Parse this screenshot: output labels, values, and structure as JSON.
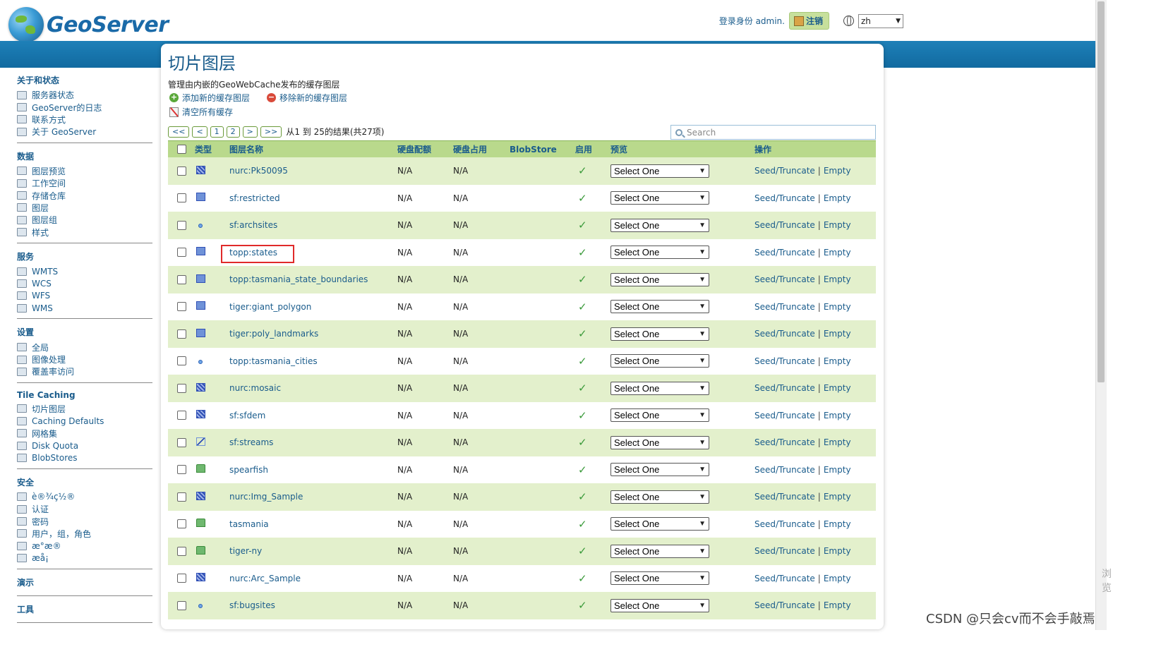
{
  "header": {
    "logo_text": "GeoServer",
    "login_text": "登录身份 admin.",
    "logout_label": "注销",
    "lang_value": "zh"
  },
  "sidebar": [
    {
      "title": "关于和状态",
      "items": [
        {
          "label": "服务器状态",
          "icon": "server-status-icon"
        },
        {
          "label": "GeoServer的日志",
          "icon": "log-icon"
        },
        {
          "label": "联系方式",
          "icon": "contact-icon"
        },
        {
          "label": "关于 GeoServer",
          "icon": "about-icon"
        }
      ]
    },
    {
      "title": "数据",
      "items": [
        {
          "label": "图层预览",
          "icon": "layer-preview-icon"
        },
        {
          "label": "工作空间",
          "icon": "workspace-icon"
        },
        {
          "label": "存储仓库",
          "icon": "store-icon"
        },
        {
          "label": "图层",
          "icon": "layer-icon"
        },
        {
          "label": "图层组",
          "icon": "layer-group-icon"
        },
        {
          "label": "样式",
          "icon": "style-icon"
        }
      ]
    },
    {
      "title": "服务",
      "items": [
        {
          "label": "WMTS",
          "icon": "wmts-icon"
        },
        {
          "label": "WCS",
          "icon": "wcs-icon"
        },
        {
          "label": "WFS",
          "icon": "wfs-icon"
        },
        {
          "label": "WMS",
          "icon": "wms-icon"
        }
      ]
    },
    {
      "title": "设置",
      "items": [
        {
          "label": "全局",
          "icon": "global-icon"
        },
        {
          "label": "图像处理",
          "icon": "image-processing-icon"
        },
        {
          "label": "覆盖率访问",
          "icon": "coverage-access-icon"
        }
      ]
    },
    {
      "title": "Tile Caching",
      "items": [
        {
          "label": "切片图层",
          "icon": "tile-layers-icon"
        },
        {
          "label": "Caching Defaults",
          "icon": "caching-defaults-icon"
        },
        {
          "label": "网格集",
          "icon": "gridset-icon"
        },
        {
          "label": "Disk Quota",
          "icon": "disk-quota-icon"
        },
        {
          "label": "BlobStores",
          "icon": "blobstore-icon"
        }
      ]
    },
    {
      "title": "安全",
      "items": [
        {
          "label": "è®¾ç½®",
          "icon": "key-icon"
        },
        {
          "label": "认证",
          "icon": "shield-icon"
        },
        {
          "label": "密码",
          "icon": "lock-icon"
        },
        {
          "label": "用户，组，角色",
          "icon": "users-icon"
        },
        {
          "label": "æ°æ®",
          "icon": "data-security-icon"
        },
        {
          "label": "æå¡",
          "icon": "service-security-icon"
        }
      ]
    },
    {
      "title": "演示",
      "items": []
    },
    {
      "title": "工具",
      "items": []
    }
  ],
  "main": {
    "title": "切片图层",
    "description": "管理由内嵌的GeoWebCache发布的缓存图层",
    "add_label": "添加新的缓存图层",
    "remove_label": "移除新的缓存图层",
    "clear_label": "清空所有缓存",
    "pager": {
      "first": "<<",
      "prev": "<",
      "p1": "1",
      "p2": "2",
      "next": ">",
      "last": ">>",
      "info": "从1 到 25的结果(共27项)"
    },
    "search_placeholder": "Search",
    "columns": {
      "type": "类型",
      "name": "图层名称",
      "quota": "硬盘配额",
      "usage": "硬盘占用",
      "blobstore": "BlobStore",
      "enabled": "启用",
      "preview": "预览",
      "ops": "操作"
    },
    "rows": [
      {
        "type": "raster",
        "name": "nurc:Pk50095",
        "quota": "N/A",
        "usage": "N/A",
        "enabled": true
      },
      {
        "type": "polygon",
        "name": "sf:restricted",
        "quota": "N/A",
        "usage": "N/A",
        "enabled": true
      },
      {
        "type": "point",
        "name": "sf:archsites",
        "quota": "N/A",
        "usage": "N/A",
        "enabled": true
      },
      {
        "type": "polygon",
        "name": "topp:states",
        "quota": "N/A",
        "usage": "N/A",
        "enabled": true
      },
      {
        "type": "polygon",
        "name": "topp:tasmania_state_boundaries",
        "quota": "N/A",
        "usage": "N/A",
        "enabled": true
      },
      {
        "type": "polygon",
        "name": "tiger:giant_polygon",
        "quota": "N/A",
        "usage": "N/A",
        "enabled": true
      },
      {
        "type": "polygon",
        "name": "tiger:poly_landmarks",
        "quota": "N/A",
        "usage": "N/A",
        "enabled": true
      },
      {
        "type": "point",
        "name": "topp:tasmania_cities",
        "quota": "N/A",
        "usage": "N/A",
        "enabled": true
      },
      {
        "type": "raster",
        "name": "nurc:mosaic",
        "quota": "N/A",
        "usage": "N/A",
        "enabled": true
      },
      {
        "type": "raster",
        "name": "sf:sfdem",
        "quota": "N/A",
        "usage": "N/A",
        "enabled": true
      },
      {
        "type": "line",
        "name": "sf:streams",
        "quota": "N/A",
        "usage": "N/A",
        "enabled": true
      },
      {
        "type": "group",
        "name": "spearfish",
        "quota": "N/A",
        "usage": "N/A",
        "enabled": true
      },
      {
        "type": "raster",
        "name": "nurc:Img_Sample",
        "quota": "N/A",
        "usage": "N/A",
        "enabled": true
      },
      {
        "type": "group",
        "name": "tasmania",
        "quota": "N/A",
        "usage": "N/A",
        "enabled": true
      },
      {
        "type": "group",
        "name": "tiger-ny",
        "quota": "N/A",
        "usage": "N/A",
        "enabled": true
      },
      {
        "type": "raster",
        "name": "nurc:Arc_Sample",
        "quota": "N/A",
        "usage": "N/A",
        "enabled": true
      },
      {
        "type": "point",
        "name": "sf:bugsites",
        "quota": "N/A",
        "usage": "N/A",
        "enabled": true
      }
    ],
    "preview_value": "Select One",
    "seed_label": "Seed/Truncate",
    "sep": "|",
    "empty_label": "Empty",
    "enabled_mark": "✓"
  },
  "watermark": "CSDN @只会cv而不会手敲焉",
  "side_char": "浏览"
}
